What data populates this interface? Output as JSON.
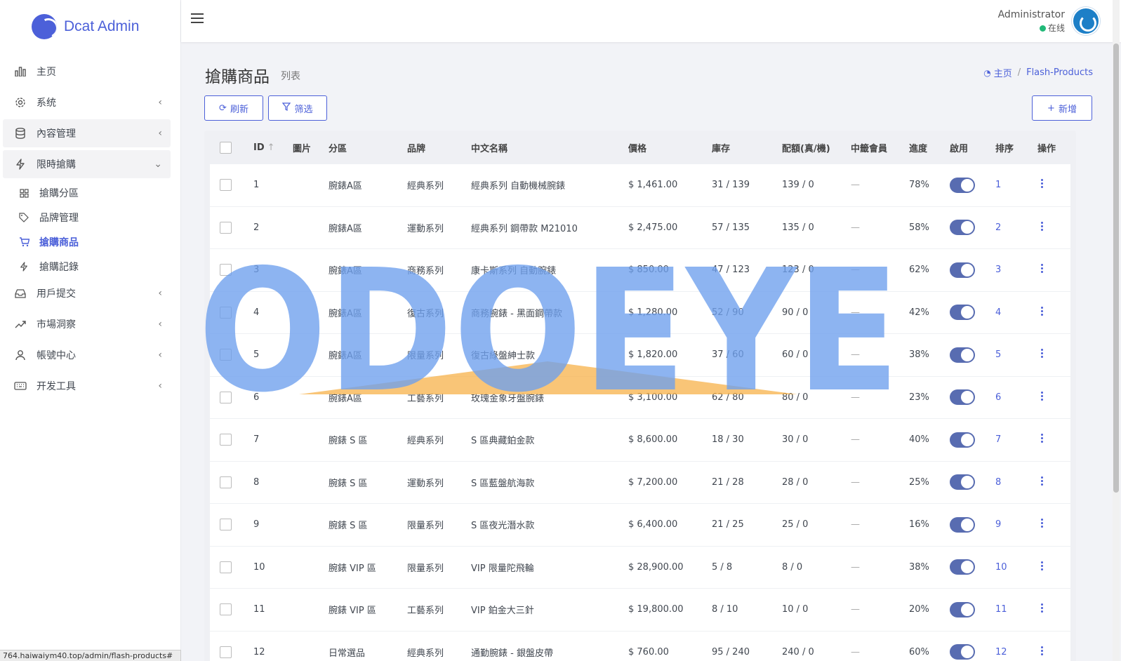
{
  "app": {
    "logo_text": "Dcat Admin",
    "brand_color": "#4c60d9"
  },
  "sidebar": {
    "items": [
      {
        "label": "主页",
        "icon": "bar-chart-icon",
        "has_arrow": false
      },
      {
        "label": "系统",
        "icon": "gear-icon",
        "has_arrow": true
      },
      {
        "label": "內容管理",
        "icon": "database-icon",
        "has_arrow": true
      },
      {
        "label": "限時搶購",
        "icon": "lightning-icon",
        "has_arrow": true
      }
    ],
    "submenu": [
      {
        "label": "搶購分區",
        "icon": "grid-icon"
      },
      {
        "label": "品牌管理",
        "icon": "tag-icon"
      },
      {
        "label": "搶購商品",
        "icon": "cart-icon"
      },
      {
        "label": "搶購記錄",
        "icon": "lightning-icon"
      }
    ],
    "items_after": [
      {
        "label": "用戶提交",
        "icon": "inbox-icon"
      },
      {
        "label": "市場洞察",
        "icon": "trend-icon"
      },
      {
        "label": "帳號中心",
        "icon": "user-icon"
      },
      {
        "label": "开发工具",
        "icon": "keyboard-icon"
      }
    ],
    "status_url": "764.haiwaiym40.top/admin/flash-products#"
  },
  "header": {
    "user_name": "Administrator",
    "user_status": "在线"
  },
  "page": {
    "title": "搶購商品",
    "description": "列表",
    "breadcrumb_home": "主页",
    "breadcrumb_current": "Flash-Products",
    "refresh_label": "刷新",
    "filter_label": "筛选",
    "new_label": "新增"
  },
  "table": {
    "columns": {
      "id": "ID",
      "img": "圖片",
      "category": "分區",
      "brand": "品牌",
      "name": "中文名稱",
      "price": "價格",
      "stock": "庫存",
      "quota": "配額(真/機)",
      "winner": "中籤會員",
      "progress": "進度",
      "enabled": "啟用",
      "sort": "排序",
      "action": "操作"
    },
    "rows": [
      {
        "id": "1",
        "category": "腕錶A區",
        "brand": "經典系列",
        "name": "經典系列 自動機械腕錶",
        "price": "$ 1,461.00",
        "stock": "31 / 139",
        "quota": "139 / 0",
        "winner": "—",
        "progress": "78%",
        "sort": "1"
      },
      {
        "id": "2",
        "category": "腕錶A區",
        "brand": "運動系列",
        "name": "經典系列 鋼帶款 M21010",
        "price": "$ 2,475.00",
        "stock": "57 / 135",
        "quota": "135 / 0",
        "winner": "—",
        "progress": "58%",
        "sort": "2"
      },
      {
        "id": "3",
        "category": "腕錶A區",
        "brand": "商務系列",
        "name": "康卡斯系列 自動腕錶",
        "price": "$ 850.00",
        "stock": "47 / 123",
        "quota": "123 / 0",
        "winner": "—",
        "progress": "62%",
        "sort": "3"
      },
      {
        "id": "4",
        "category": "腕錶A區",
        "brand": "復古系列",
        "name": "商務腕錶 - 黑面鋼帶款",
        "price": "$ 1,280.00",
        "stock": "52 / 90",
        "quota": "90 / 0",
        "winner": "—",
        "progress": "42%",
        "sort": "4"
      },
      {
        "id": "5",
        "category": "腕錶A區",
        "brand": "限量系列",
        "name": "復古綠盤紳士款",
        "price": "$ 1,820.00",
        "stock": "37 / 60",
        "quota": "60 / 0",
        "winner": "—",
        "progress": "38%",
        "sort": "5"
      },
      {
        "id": "6",
        "category": "腕錶A區",
        "brand": "工藝系列",
        "name": "玫瑰金象牙盤腕錶",
        "price": "$ 3,100.00",
        "stock": "62 / 80",
        "quota": "80 / 0",
        "winner": "—",
        "progress": "23%",
        "sort": "6"
      },
      {
        "id": "7",
        "category": "腕錶 S 區",
        "brand": "經典系列",
        "name": "S 區典藏鉑金款",
        "price": "$ 8,600.00",
        "stock": "18 / 30",
        "quota": "30 / 0",
        "winner": "—",
        "progress": "40%",
        "sort": "7"
      },
      {
        "id": "8",
        "category": "腕錶 S 區",
        "brand": "運動系列",
        "name": "S 區藍盤航海款",
        "price": "$ 7,200.00",
        "stock": "21 / 28",
        "quota": "28 / 0",
        "winner": "—",
        "progress": "25%",
        "sort": "8"
      },
      {
        "id": "9",
        "category": "腕錶 S 區",
        "brand": "限量系列",
        "name": "S 區夜光潛水款",
        "price": "$ 6,400.00",
        "stock": "21 / 25",
        "quota": "25 / 0",
        "winner": "—",
        "progress": "16%",
        "sort": "9"
      },
      {
        "id": "10",
        "category": "腕錶 VIP 區",
        "brand": "限量系列",
        "name": "VIP 限量陀飛輪",
        "price": "$ 28,900.00",
        "stock": "5 / 8",
        "quota": "8 / 0",
        "winner": "—",
        "progress": "38%",
        "sort": "10"
      },
      {
        "id": "11",
        "category": "腕錶 VIP 區",
        "brand": "工藝系列",
        "name": "VIP 鉑金大三針",
        "price": "$ 19,800.00",
        "stock": "8 / 10",
        "quota": "10 / 0",
        "winner": "—",
        "progress": "20%",
        "sort": "11"
      },
      {
        "id": "12",
        "category": "日常選品",
        "brand": "經典系列",
        "name": "通勤腕錶 - 銀盤皮帶",
        "price": "$ 760.00",
        "stock": "95 / 240",
        "quota": "240 / 0",
        "winner": "—",
        "progress": "60%",
        "sort": "12"
      }
    ]
  },
  "watermark": {
    "text": "ODOEYE",
    "color": "#6ea0ee",
    "accent": "#f7b24a"
  }
}
